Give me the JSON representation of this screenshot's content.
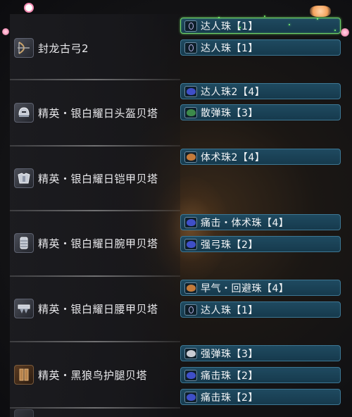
{
  "equipment": [
    {
      "name": "封龙古弓2",
      "icon": "bow-icon"
    },
    {
      "name": "精英・银白耀日头盔贝塔",
      "icon": "helmet-icon"
    },
    {
      "name": "精英・银白耀日铠甲贝塔",
      "icon": "chest-armor-icon"
    },
    {
      "name": "精英・银白耀日腕甲贝塔",
      "icon": "gauntlet-icon"
    },
    {
      "name": "精英・银白耀日腰甲贝塔",
      "icon": "waist-armor-icon"
    },
    {
      "name": "精英・黑狼鸟护腿贝塔",
      "icon": "leg-armor-icon"
    }
  ],
  "decorations": [
    {
      "text": "达人珠【1】",
      "gem": "lvl1",
      "selected": true
    },
    {
      "text": "达人珠【1】",
      "gem": "lvl1"
    },
    {
      "text": "达人珠2【4】",
      "gem": "blue"
    },
    {
      "text": "散弹珠【3】",
      "gem": "green"
    },
    {
      "text": "体术珠2【4】",
      "gem": "orange"
    },
    {
      "text": "痛击・体术珠【4】",
      "gem": "blue"
    },
    {
      "text": "强弓珠【2】",
      "gem": "blue"
    },
    {
      "text": "早气・回避珠【4】",
      "gem": "orange"
    },
    {
      "text": "达人珠【1】",
      "gem": "lvl1"
    },
    {
      "text": "强弹珠【3】",
      "gem": "silver"
    },
    {
      "text": "痛击珠【2】",
      "gem": "blue"
    },
    {
      "text": "痛击珠【2】",
      "gem": "blue"
    }
  ],
  "colors": {
    "slot_bg": "#1f4a60",
    "slot_border": "#3d7794",
    "selected_border": "#6fd36a",
    "gem_blue": "#3f4fc8",
    "gem_green": "#3c8a4a",
    "gem_orange": "#c47a3a",
    "gem_silver": "#c9cbd2"
  }
}
